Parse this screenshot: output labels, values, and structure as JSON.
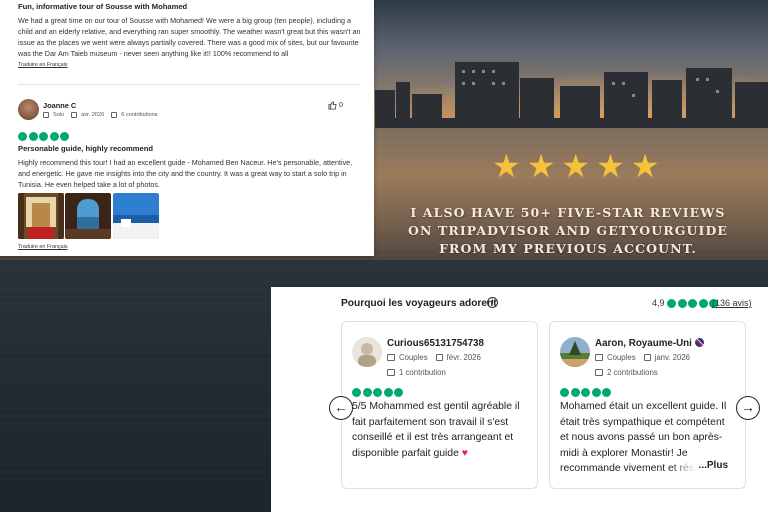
{
  "promo": {
    "stars": [
      "★",
      "★",
      "★",
      "★",
      "★"
    ],
    "tagline": "I also have 50+ five-star reviews on Tripadvisor and GetYourGuide from my previous account."
  },
  "top_card": {
    "review1": {
      "title": "Fun, informative tour of Sousse with Mohamed",
      "body": "We had a great time on our tour of Sousse with Mohamed! We were a big group (ten people), including a child and an elderly relative, and everything ran super smoothly. The weather wasn't great but this wasn't an issue as the places we went were always partially covered. There was a good mix of sites, but our favourite was the Dar Am Taieb museum - never seen anything like it!! 100% recommend to all",
      "translate": "Traduire en Français"
    },
    "review2": {
      "reviewer": "Joanne C",
      "trip_type": "Solo",
      "date": "avr. 2026",
      "contributions": "6 contributions",
      "likes": "0",
      "rating": 5,
      "title": "Personable guide, highly recommend",
      "body": "Highly recommend this tour! I had an excellent guide - Mohamed Ben Naceur. He's personable, attentive, and energetic. He gave me insights into the city and the country. It was a great way to start a solo trip in Tunisia. He even helped take a lot of photos.",
      "translate": "Traduire en Français"
    }
  },
  "carousel": {
    "title": "Pourquoi les voyageurs adorent",
    "rating": "4,9",
    "review_count": "(136 avis)",
    "prev_icon": "←",
    "next_icon": "→",
    "cards": [
      {
        "name": "Curious65131754738",
        "trip_type": "Couples",
        "date": "févr. 2026",
        "contributions": "1 contribution",
        "rating": 5,
        "body": "5/5 Mohammed est gentil agréable il fait parfaitement son travail il s'est conseillé et il est très arrangeant et disponible parfait guide",
        "heart": "♥"
      },
      {
        "name": "Aaron, Royaume-Uni",
        "trip_type": "Couples",
        "date": "janv. 2026",
        "contributions": "2 contributions",
        "rating": 5,
        "body": "Mohamed était un excellent guide. Il était très sympathique et compétent et nous avons passé un bon après-midi à explorer Monastir! Je recommande vivement et rése",
        "more": "...Plus"
      }
    ]
  },
  "colors": {
    "tripadvisor_green": "#00aa6c",
    "star_gold": "#f6c23c"
  }
}
